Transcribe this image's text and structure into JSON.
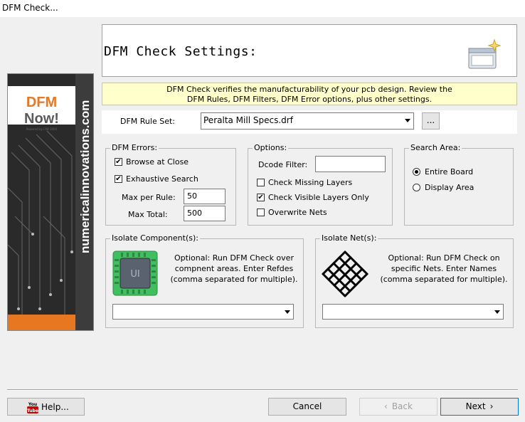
{
  "window": {
    "title": "DFM Check..."
  },
  "header": {
    "title": "DFM Check Settings:"
  },
  "banner": {
    "line1": "DFM Check verifies the manufacturability of your pcb design.  Review the",
    "line2": "DFM Rules, DFM Filters, DFM Error options, plus other settings."
  },
  "sidebar": {
    "logo_dfm": "DFM",
    "logo_now": "Now!",
    "logo_powered": "Powered by FAB 3000",
    "url": "numericalinnovations.com"
  },
  "ruleset": {
    "label": "DFM Rule Set:",
    "value": "Peralta Mill Specs.drf",
    "browse_label": "..."
  },
  "dfm_errors": {
    "title": "DFM Errors:",
    "browse_at_close": {
      "label": "Browse at Close",
      "checked": true
    },
    "exhaustive_search": {
      "label": "Exhaustive Search",
      "checked": true
    },
    "max_per_rule_label": "Max per Rule:",
    "max_per_rule_value": "50",
    "max_total_label": "Max Total:",
    "max_total_value": "500"
  },
  "options": {
    "title": "Options:",
    "dcode_filter_label": "Dcode Filter:",
    "dcode_filter_value": "",
    "check_missing_layers": {
      "label": "Check Missing Layers",
      "checked": false
    },
    "check_visible_layers": {
      "label": "Check Visible Layers Only",
      "checked": true
    },
    "overwrite_nets": {
      "label": "Overwrite Nets",
      "checked": false
    }
  },
  "search_area": {
    "title": "Search Area:",
    "entire_board": {
      "label": "Entire Board",
      "selected": true
    },
    "display_area": {
      "label": "Display Area",
      "selected": false
    }
  },
  "isolate_components": {
    "title": "Isolate Component(s):",
    "chip_label": "UI",
    "desc1": "Optional: Run DFM Check over",
    "desc2": "compnent areas. Enter Refdes",
    "desc3": "(comma separated for multiple).",
    "value": ""
  },
  "isolate_nets": {
    "title": "Isolate Net(s):",
    "desc1": "Optional: Run DFM Check on",
    "desc2": "specific Nets. Enter Names",
    "desc3": "(comma separated for multiple).",
    "value": ""
  },
  "footer": {
    "help_label": "Help...",
    "help_icon_text": "You Tube",
    "cancel_label": "Cancel",
    "back_label": "Back",
    "next_label": "Next"
  },
  "colors": {
    "accent_orange": "#e87722",
    "banner_bg": "#ffffcc",
    "chip_green": "#3fbf5f"
  }
}
